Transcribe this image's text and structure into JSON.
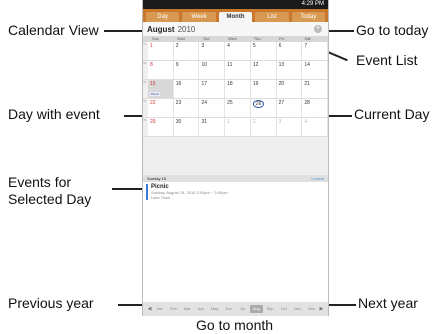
{
  "callouts": {
    "calendar_view": "Calendar View",
    "go_to_today": "Go to today",
    "event_list": "Event List",
    "day_with_event": "Day with event",
    "current_day": "Current Day",
    "events_for_day_1": "Events for",
    "events_for_day_2": "Selected Day",
    "previous_year": "Previous year",
    "next_year": "Next year",
    "go_to_month": "Go to month"
  },
  "status": {
    "time": "4:29 PM"
  },
  "tabs": {
    "day": "Day",
    "week": "Week",
    "month": "Month",
    "list": "List",
    "today": "Today"
  },
  "header": {
    "month": "August",
    "year": "2010",
    "add_icon": "plus-icon"
  },
  "dow": [
    "Sun",
    "Mon",
    "Tue",
    "Wed",
    "Thu",
    "Fri",
    "Sat"
  ],
  "weeks": [
    {
      "wk": "31",
      "days": [
        "1",
        "2",
        "3",
        "4",
        "5",
        "6",
        "7"
      ]
    },
    {
      "wk": "32",
      "days": [
        "8",
        "9",
        "10",
        "11",
        "12",
        "13",
        "14"
      ]
    },
    {
      "wk": "33",
      "days": [
        "15",
        "16",
        "17",
        "18",
        "19",
        "20",
        "21"
      ]
    },
    {
      "wk": "34",
      "days": [
        "22",
        "23",
        "24",
        "25",
        "26",
        "27",
        "28"
      ]
    },
    {
      "wk": "35",
      "days": [
        "29",
        "30",
        "31",
        "1",
        "2",
        "3",
        "4"
      ]
    }
  ],
  "event_marker": "Picnic",
  "selected_day": {
    "title": "Sunday 15",
    "count": "1 event"
  },
  "event": {
    "title": "Picnic",
    "when": "Sunday, August 15, 2010 2:00pm ~ 3:00pm",
    "where": "Lake Town"
  },
  "months": [
    "Jan",
    "Feb",
    "Mar",
    "Apr",
    "May",
    "Jun",
    "Jul",
    "Aug",
    "Sep",
    "Oct",
    "Nov",
    "Dec"
  ]
}
